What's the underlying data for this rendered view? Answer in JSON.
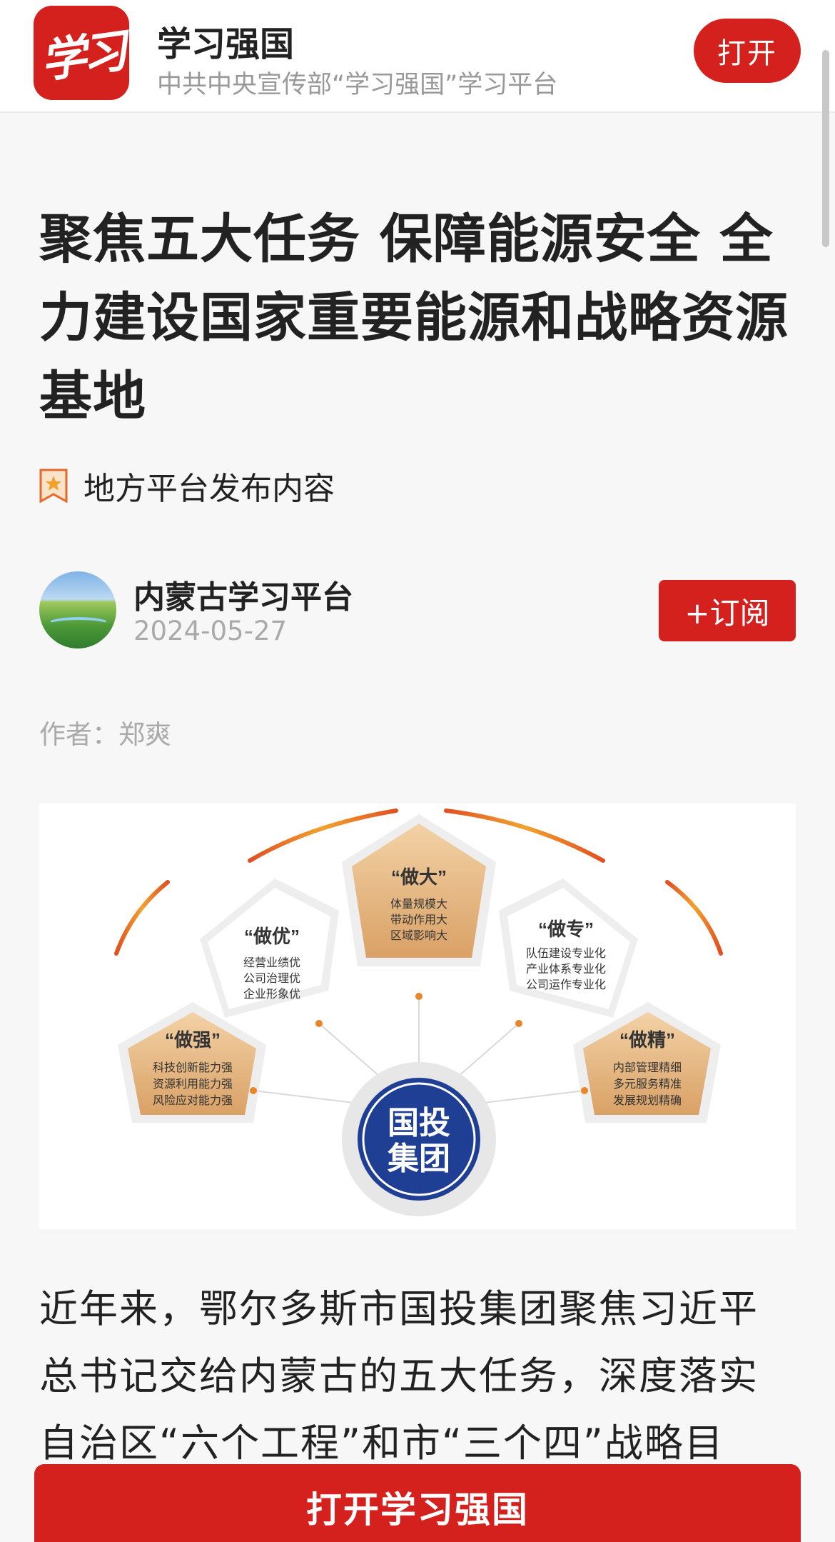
{
  "app_banner": {
    "logo_text": "学习",
    "name": "学习强国",
    "subtitle": "中共中央宣传部“学习强国”学习平台",
    "open_label": "打开"
  },
  "article": {
    "title": "聚焦五大任务 保障能源安全 全力建设国家重要能源和战略资源基地",
    "source_tag": "地方平台发布内容",
    "publisher": {
      "name": "内蒙古学习平台",
      "date": "2024-05-27",
      "subscribe_label": "+订阅"
    },
    "author": "作者：郑爽",
    "body": "近年来，鄂尔多斯市国投集团聚焦习近平总书记交给内蒙古的五大任务，深度落实自治区“六个工程”和市“三个四”战略目"
  },
  "figure": {
    "center": [
      "国投",
      "集团"
    ],
    "pentagons": [
      {
        "title": "“做强”",
        "lines": [
          "科技创新能力强",
          "资源利用能力强",
          "风险应对能力强"
        ]
      },
      {
        "title": "“做优”",
        "lines": [
          "经营业绩优",
          "公司治理优",
          "企业形象优"
        ]
      },
      {
        "title": "“做大”",
        "lines": [
          "体量规模大",
          "带动作用大",
          "区域影响大"
        ]
      },
      {
        "title": "“做专”",
        "lines": [
          "队伍建设专业化",
          "产业体系专业化",
          "公司运作专业化"
        ]
      },
      {
        "title": "“做精”",
        "lines": [
          "内部管理精细",
          "多元服务精准",
          "发展规划精确"
        ]
      }
    ]
  },
  "bottom_bar": {
    "label": "打开学习强国"
  },
  "colors": {
    "brand_red": "#d5211e",
    "pentagon_gold": "#e2b27a",
    "center_blue": "#1f3f94"
  }
}
